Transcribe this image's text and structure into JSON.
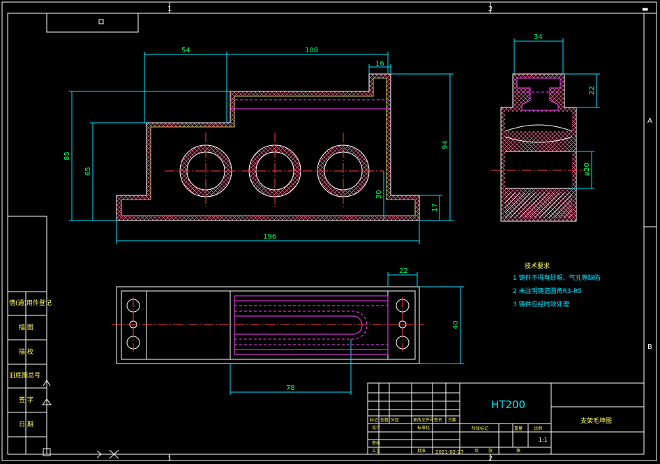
{
  "zones": {
    "top_1": "1",
    "top_2": "2",
    "bottom_1": "1",
    "bottom_2": "2",
    "right_a": "A",
    "right_b": "B"
  },
  "dimensions": {
    "d54": "54",
    "d108": "108",
    "d16": "16",
    "d85": "85",
    "d65": "65",
    "d94": "94",
    "d30": "30",
    "d17": "17",
    "d196": "196",
    "d34": "34",
    "d22_top": "22",
    "d020": "ø20",
    "d22_plan": "22",
    "d40": "40",
    "d78": "78"
  },
  "tech_notes": {
    "title": "技术要求",
    "line1": "1 铸件不得有砂眼、气孔等缺陷",
    "line2": "2 未注明铸造圆角R3-R5",
    "line3": "3 铸件应经时效处理"
  },
  "side_labels": {
    "l1": "借(通)用件登记",
    "l2": "描 图",
    "l3": "描 校",
    "l4": "旧底图总号",
    "l5": "签 字",
    "l6": "日 期"
  },
  "title_block": {
    "material": "HT200",
    "part_name": "支架毛坤图",
    "scale": "1:1",
    "date": "2021-02-27",
    "h_mark": "标记",
    "h_count": "处数",
    "h_zone": "分区",
    "h_docno": "更改文件号",
    "h_sign": "签名",
    "h_date": "日期",
    "h_design": "设计",
    "h_std": "标准化",
    "h_stage": "阶段标记",
    "h_weight": "重量",
    "h_ratio": "比例",
    "h_review": "审核",
    "h_process": "工艺",
    "h_approve": "批准",
    "h_total": "共",
    "h_sheets": "张",
    "h_no": "第"
  }
}
